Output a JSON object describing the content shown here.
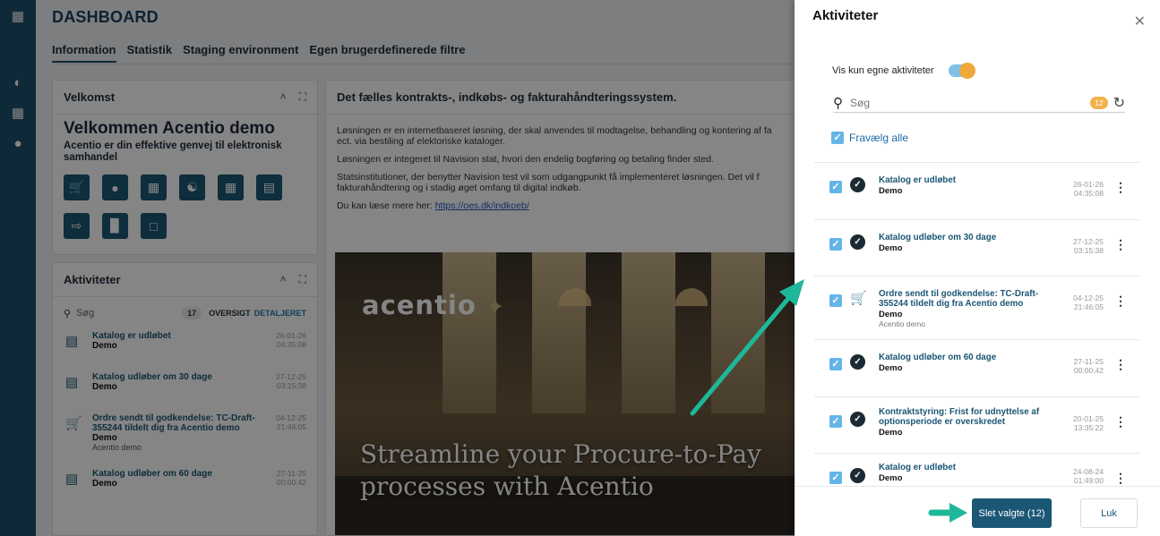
{
  "rail": {
    "icons": [
      "apps-grid-icon",
      "speedometer-icon",
      "excel-icon",
      "user-lock-icon"
    ]
  },
  "dashboard": {
    "title": "DASHBOARD",
    "tabs": [
      "Information",
      "Statistik",
      "Staging environment",
      "Egen brugerdefinerede filtre"
    ],
    "welcome": {
      "card_title": "Velkomst",
      "heading": "Velkommen Acentio demo",
      "sub": "Acentio er din effektive genvej til elektronisk samhandel"
    },
    "activities": {
      "card_title": "Aktiviteter",
      "search_placeholder": "Søg",
      "count": "17",
      "overview": "OVERSIGT",
      "detailed": "DETALJERET",
      "items": [
        {
          "title": "Katalog er udløbet",
          "sub": "Demo",
          "sub2": "",
          "date": "26-01-26",
          "time": "04:35:08"
        },
        {
          "title": "Katalog udløber om 30 dage",
          "sub": "Demo",
          "sub2": "",
          "date": "27-12-25",
          "time": "03:15:38"
        },
        {
          "title": "Ordre sendt til godkendelse: TC-Draft-355244 tildelt dig fra Acentio demo",
          "sub": "Demo",
          "sub2": "Acentio demo",
          "date": "04-12-25",
          "time": "21:46:05"
        },
        {
          "title": "Katalog udløber om 60 dage",
          "sub": "Demo",
          "sub2": "",
          "date": "27-11-25",
          "time": "00:00:42"
        }
      ]
    },
    "info": {
      "title": "Det fælles kontrakts-, indkøbs- og fakturahåndteringssystem.",
      "p1": "Løsningen er en internetbaseret løsning, der skal anvendes til modtagelse, behandling og kontering af fa",
      "p1b": "ect.  via bestiling af elektoriske kataloger.",
      "p2": "Løsningen er integeret til Navision stat, hvori den endelig bogføring og betaling finder sted.",
      "p3": "Statsinstitutioner, der benytter Navision test vil som udgangpunkt få implementeret løsningen. Det vil f",
      "p3b": "fakturahåndtering og i stadig øget omfang til digital indkøb.",
      "p4": "Du kan læse mere her: ",
      "link": "https://oes.dk/indkoeb/",
      "banner_logo": "acentio",
      "banner_line1": "Streamline your Procure-to-Pay",
      "banner_line2": "processes with Acentio"
    }
  },
  "drawer": {
    "title": "Aktiviteter",
    "toggle_label": "Vis kun egne aktiviteter",
    "search_placeholder": "Søg",
    "count_badge": "12",
    "deselect_all": "Fravælg alle",
    "items": [
      {
        "title": "Katalog er udløbet",
        "sub": "Demo",
        "sub2": "",
        "date": "26-01-26",
        "time": "04:35:08",
        "icon": "check-circle-icon"
      },
      {
        "title": "Katalog udløber om 30 dage",
        "sub": "Demo",
        "sub2": "",
        "date": "27-12-25",
        "time": "03:15:38",
        "icon": "check-circle-icon"
      },
      {
        "title": "Ordre sendt til godkendelse: TC-Draft-355244 tildelt dig fra Acentio demo",
        "sub": "Demo",
        "sub2": "Acentio demo",
        "date": "04-12-25",
        "time": "21:46:05",
        "icon": "cart-icon"
      },
      {
        "title": "Katalog udløber om 60 dage",
        "sub": "Demo",
        "sub2": "",
        "date": "27-11-25",
        "time": "00:00:42",
        "icon": "check-circle-icon"
      },
      {
        "title": "Kontraktstyring: Frist for udnyttelse af optionsperiode er overskredet",
        "sub": "Demo",
        "sub2": "",
        "date": "20-01-25",
        "time": "13:35:22",
        "icon": "check-circle-icon"
      },
      {
        "title": "Katalog er udløbet",
        "sub": "Demo",
        "sub2": "",
        "date": "24-08-24",
        "time": "01:49:00",
        "icon": "check-circle-icon"
      }
    ],
    "delete_button": "Slet valgte (12)",
    "close_button": "Luk"
  },
  "colors": {
    "brand": "#1b5675",
    "rail": "#1b4f6b",
    "toggle_knob": "#f0a83a",
    "annotation_arrow": "#1fb79a"
  }
}
